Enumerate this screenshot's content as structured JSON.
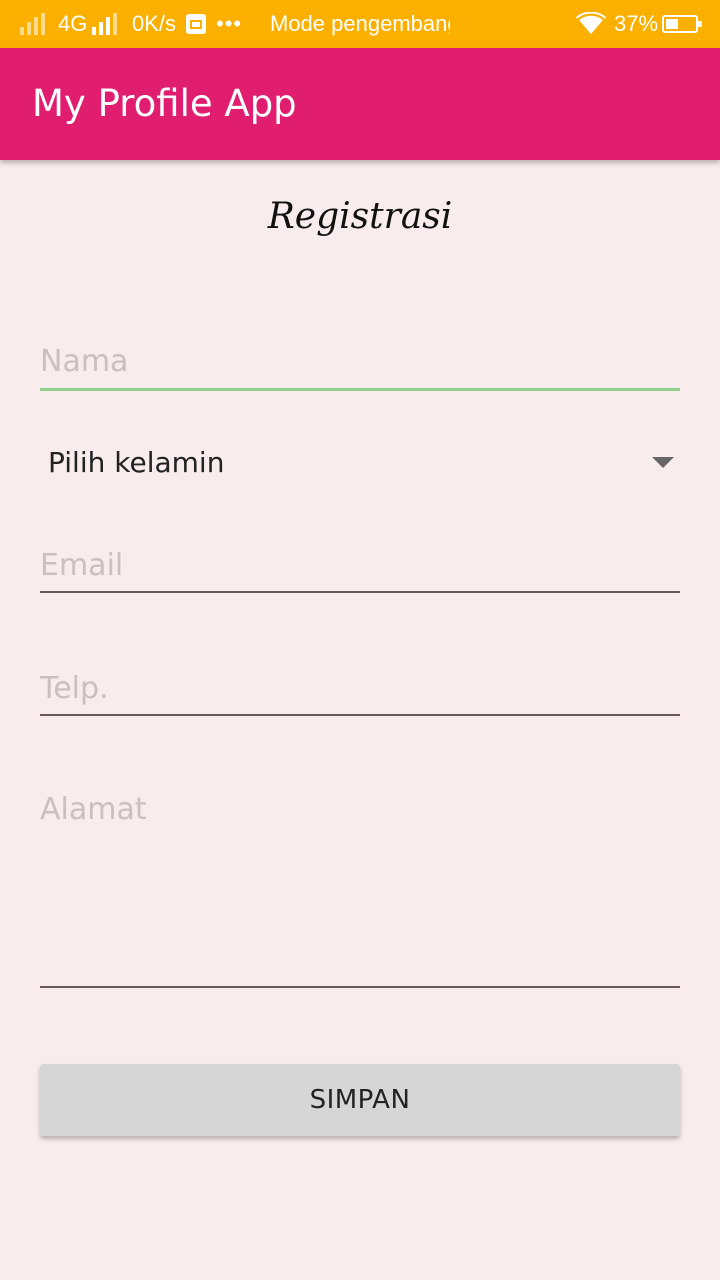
{
  "status_bar": {
    "network": "4G",
    "speed": "0K/s",
    "dots": "•••",
    "mode_text": "Mode pengembang",
    "battery": "37%",
    "battery_level": 0.37
  },
  "app_bar": {
    "title": "My Profile App"
  },
  "form": {
    "title": "Registrasi",
    "name_placeholder": "Nama",
    "gender_label": "Pilih kelamin",
    "email_placeholder": "Email",
    "phone_placeholder": "Telp.",
    "address_placeholder": "Alamat",
    "save_label": "SIMPAN"
  },
  "colors": {
    "status_bar": "#fbb000",
    "app_bar": "#e01d6f",
    "background": "#f8ecec",
    "active_underline": "#8fcf88",
    "button": "#d6d6d6"
  }
}
